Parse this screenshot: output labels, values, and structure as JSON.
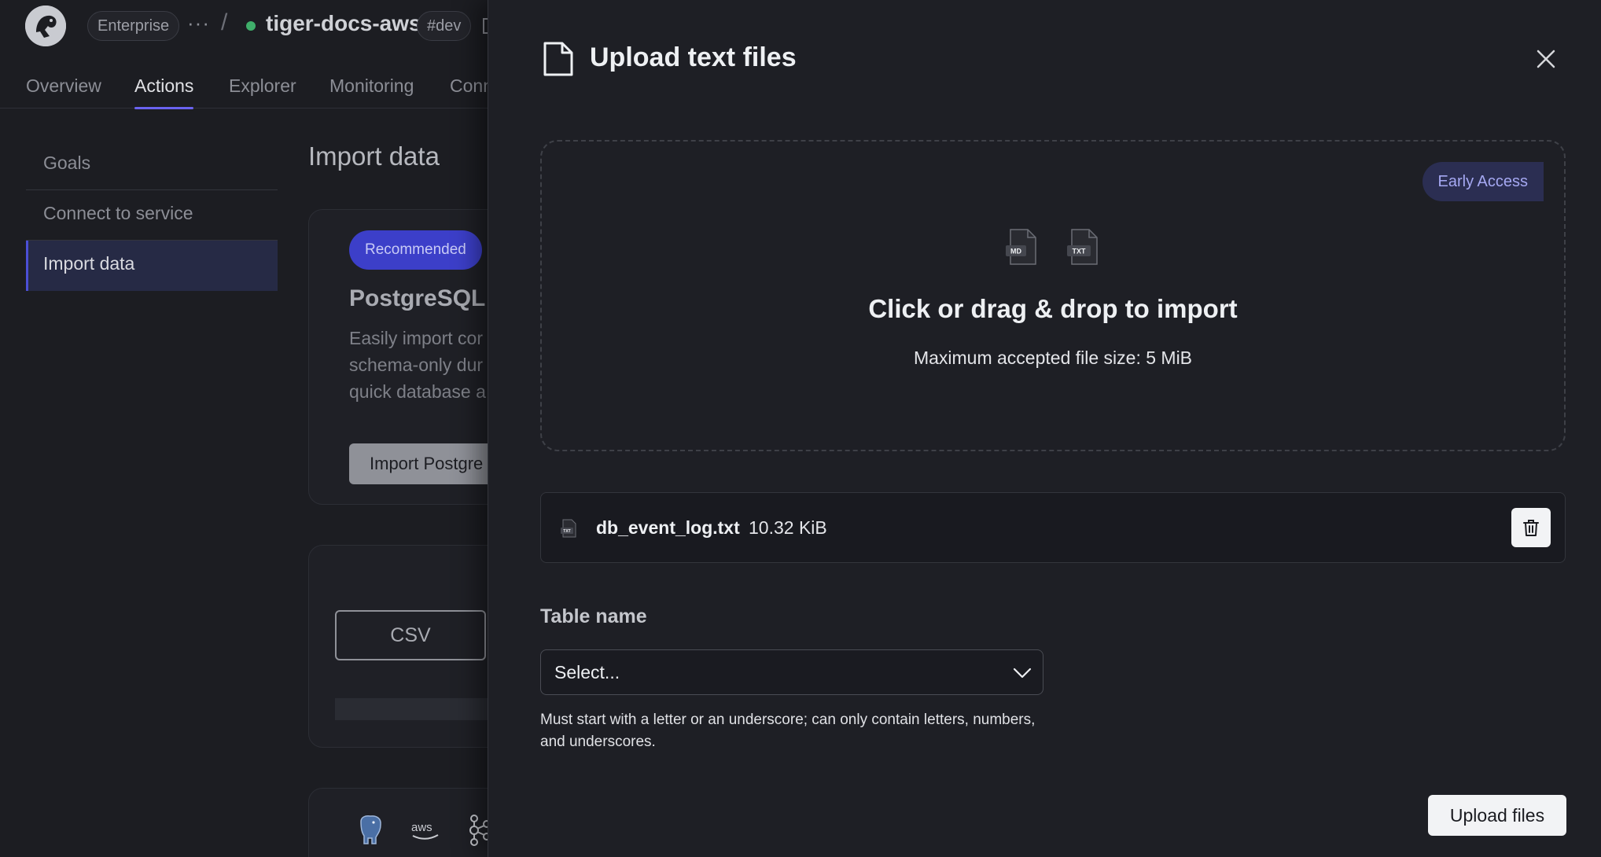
{
  "header": {
    "plan": "Enterprise",
    "more": "···",
    "separator": "/",
    "service_name": "tiger-docs-aws",
    "environment": "#dev",
    "status_color": "#3fae6a"
  },
  "nav": {
    "tabs": [
      {
        "label": "Overview"
      },
      {
        "label": "Actions",
        "active": true
      },
      {
        "label": "Explorer"
      },
      {
        "label": "Monitoring"
      },
      {
        "label": "Conn"
      }
    ]
  },
  "sidebar": {
    "items": [
      {
        "label": "Goals"
      },
      {
        "label": "Connect to service"
      },
      {
        "label": "Import data",
        "active": true
      }
    ]
  },
  "main": {
    "page_title": "Import data",
    "postgres_card": {
      "badge": "Recommended",
      "title": "PostgreSQL I",
      "description_lines": [
        "Easily import cor",
        "schema-only dur",
        "quick database a"
      ],
      "button": "Import Postgre"
    },
    "file_card": {
      "csv_button": "CSV"
    },
    "source_icons": [
      "postgres-elephant-icon",
      "aws-icon",
      "kafka-icon"
    ]
  },
  "panel": {
    "title": "Upload text files",
    "dropzone": {
      "badge": "Early Access",
      "file_types": [
        "MD",
        "TXT"
      ],
      "title": "Click or drag & drop to import",
      "subtitle": "Maximum accepted file size: 5 MiB"
    },
    "file": {
      "type": "TXT",
      "name": "db_event_log.txt",
      "size": "10.32 KiB"
    },
    "table_name": {
      "label": "Table name",
      "placeholder": "Select...",
      "helper": "Must start with a letter or an underscore; can only contain letters, numbers, and underscores."
    },
    "upload_button": "Upload files"
  },
  "colors": {
    "accent": "#6a63f0",
    "recommended_badge": "#3c3fc9",
    "early_access_badge": "#2b2e52",
    "panel_bg": "#1e1f25"
  }
}
